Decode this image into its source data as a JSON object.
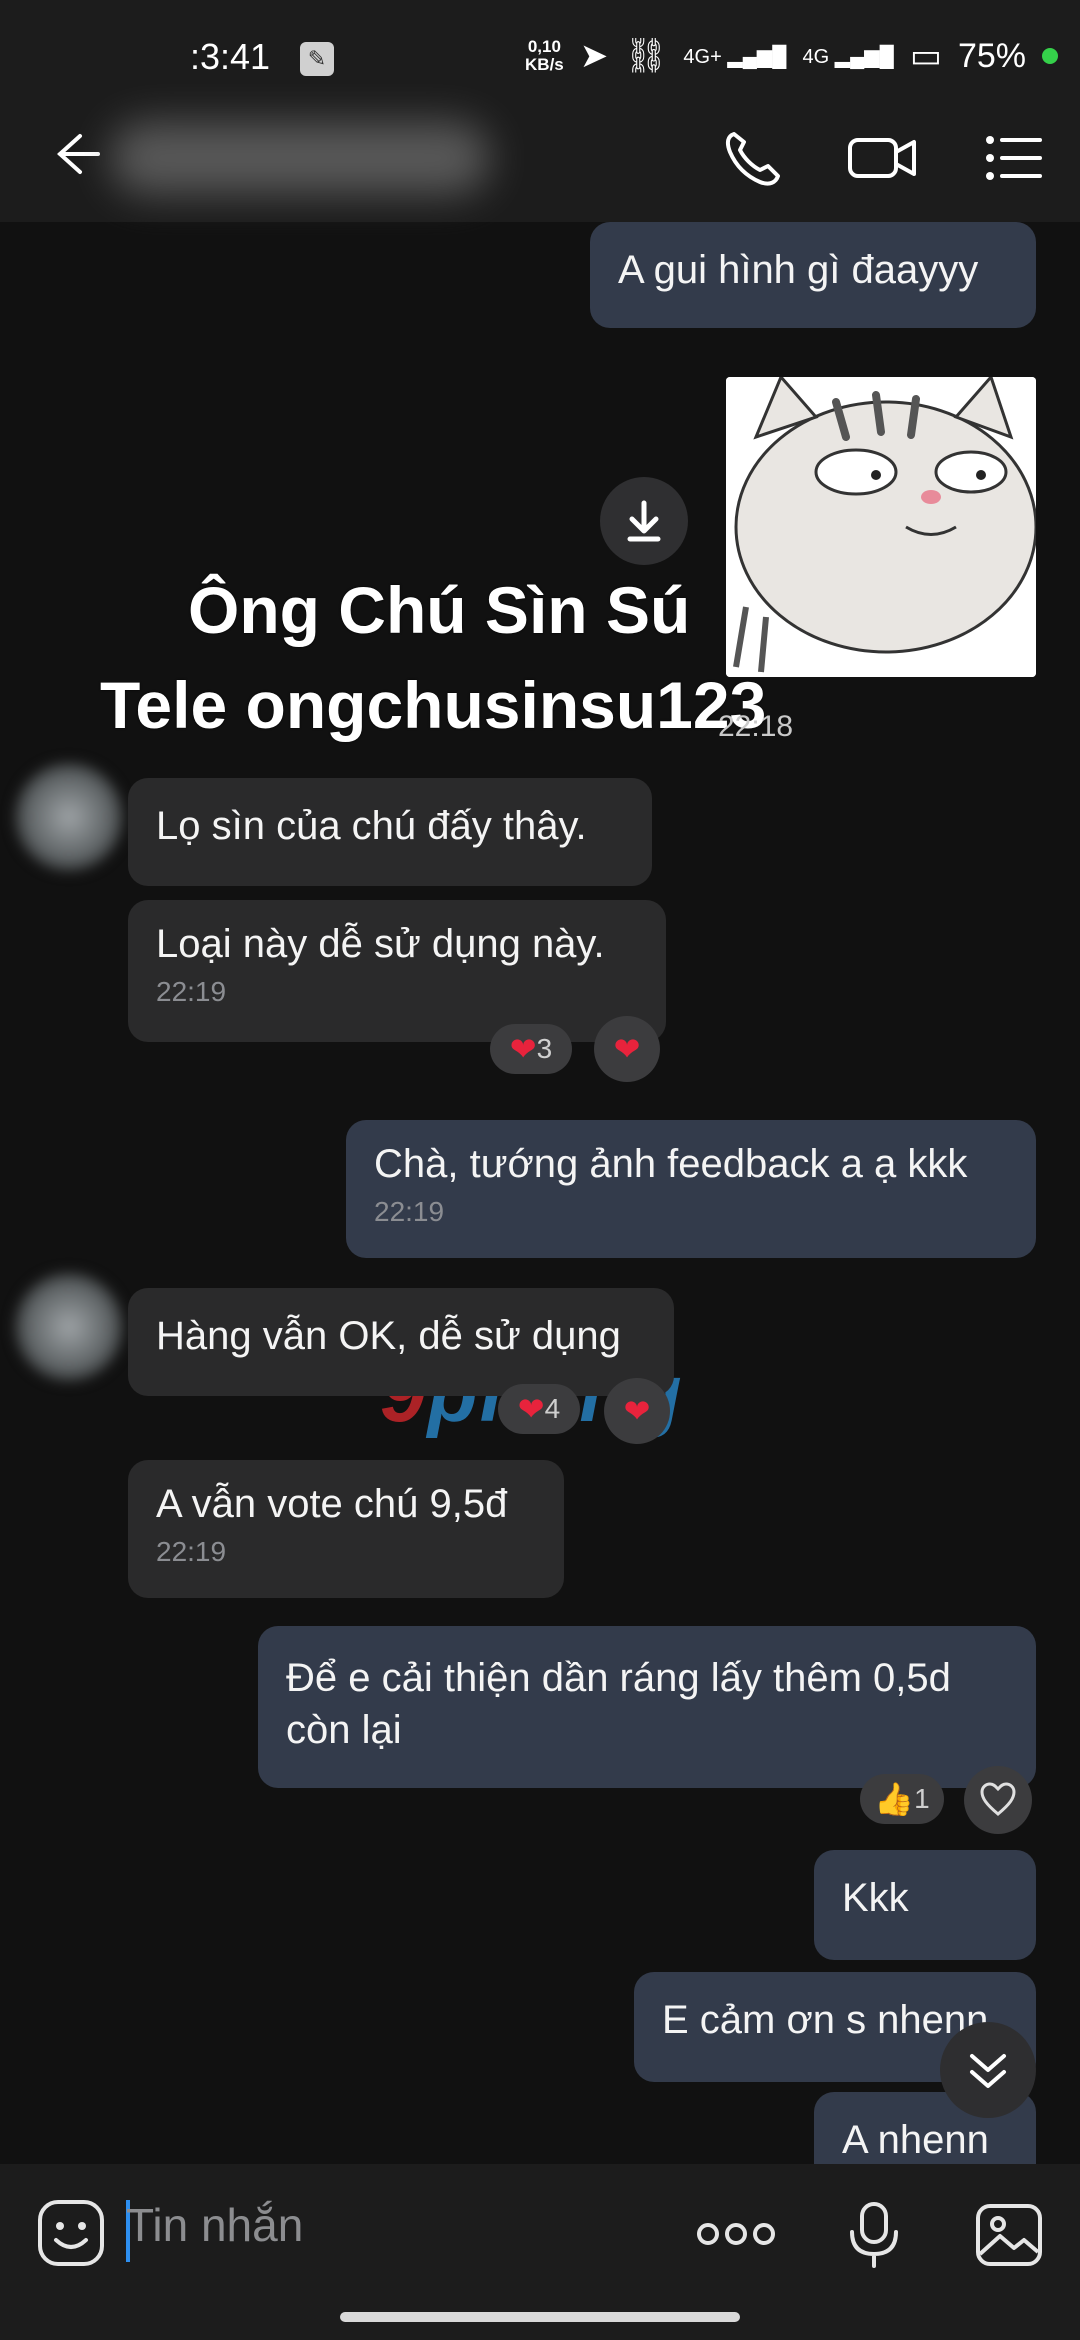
{
  "status_bar": {
    "time": ":3:41",
    "net_speed_value": "0,10",
    "net_speed_unit": "KB/s",
    "signal_1": "4G+",
    "signal_2": "4G",
    "battery": "75%"
  },
  "header": {
    "icons": [
      "back-arrow-icon",
      "phone-icon",
      "video-call-icon",
      "menu-icon"
    ]
  },
  "messages": {
    "m1": {
      "text": "A gui hình gì đaayyy"
    },
    "sticker": {
      "line1": "Ông Chú Sìn Sú",
      "line2": "Tele ongchusinsu123",
      "time": "22:18"
    },
    "m2": {
      "text": "Lọ sìn của chú đấy thây."
    },
    "m3": {
      "text": "Loại này dễ sử dụng này.",
      "time": "22:19",
      "reaction_count": "3"
    },
    "m4": {
      "text": "Chà, tướng ảnh feedback a ạ kkk",
      "time": "22:19"
    },
    "m5": {
      "text": "Hàng vẫn OK, dễ sử dụng",
      "reaction_count": "4"
    },
    "m6": {
      "text": "A vẫn vote chú 9,5đ",
      "time": "22:19"
    },
    "m7": {
      "text": "Để e cải thiện dần ráng lấy thêm 0,5d còn lại",
      "reaction_count": "1"
    },
    "m8": {
      "text": "Kkk"
    },
    "m9": {
      "text": "E cảm ơn s nhenn"
    },
    "m10": {
      "text": "A nhenn"
    }
  },
  "watermark": {
    "part1": "9",
    "part2": "phang"
  },
  "input": {
    "placeholder": "Tin nhắn"
  },
  "colors": {
    "background": "#111111",
    "incoming_bubble": "#2a2a2b",
    "outgoing_bubble": "#333b4b",
    "accent": "#2e8ff0",
    "heart": "#e8233c"
  }
}
